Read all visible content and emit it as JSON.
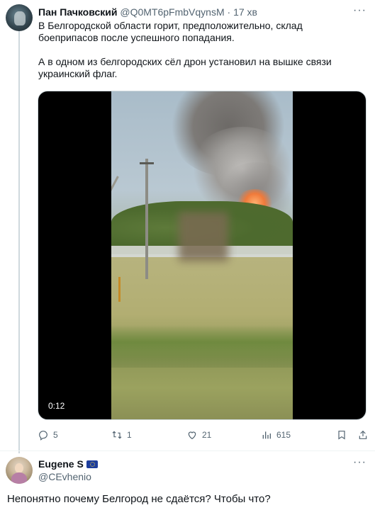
{
  "tweet": {
    "author_name": "Пан Пачковский",
    "author_handle": "@Q0MT6pFmbVqynsM",
    "separator": "·",
    "time": "17 хв",
    "more_icon": "more-dots-icon",
    "text_paragraph_1": "В Белгородской области горит, предположительно, склад боеприпасов после успешного попадания.",
    "text_paragraph_2": "А в одном из белгородских сёл дрон установил на вышке связи украинский флаг.",
    "video": {
      "timecode": "0:12"
    },
    "actions": {
      "reply_count": "5",
      "retweet_count": "1",
      "like_count": "21",
      "views_count": "615"
    }
  },
  "reply": {
    "author_name": "Eugene S",
    "badge_icon": "eu-flag-icon",
    "author_handle": "@CEvhenio",
    "text": "Непонятно почему Белгород не сдаётся? Чтобы что?"
  },
  "colors": {
    "text_primary": "#0f1419",
    "text_secondary": "#536471",
    "divider": "#eff3f4"
  }
}
